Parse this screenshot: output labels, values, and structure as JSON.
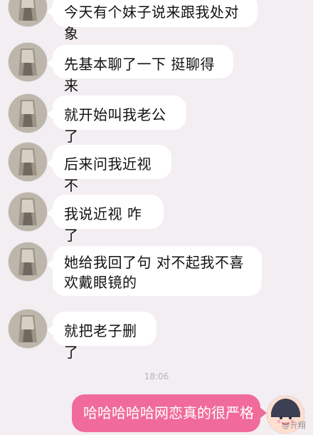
{
  "conversation": {
    "messages": [
      {
        "text": "今天有个妹子说来跟我处对象"
      },
      {
        "text": "先基本聊了一下 挺聊得来"
      },
      {
        "text": "就开始叫我老公了"
      },
      {
        "text": "后来问我近视不"
      },
      {
        "text": "我说近视 咋了"
      },
      {
        "text": "她给我回了句 对不起我不喜欢戴眼镜的"
      },
      {
        "text": "就把老子删了"
      }
    ],
    "timestamp": "18:06",
    "reply": {
      "text": "哈哈哈哈哈网恋真的很严格"
    }
  },
  "watermark": "@亓翔"
}
